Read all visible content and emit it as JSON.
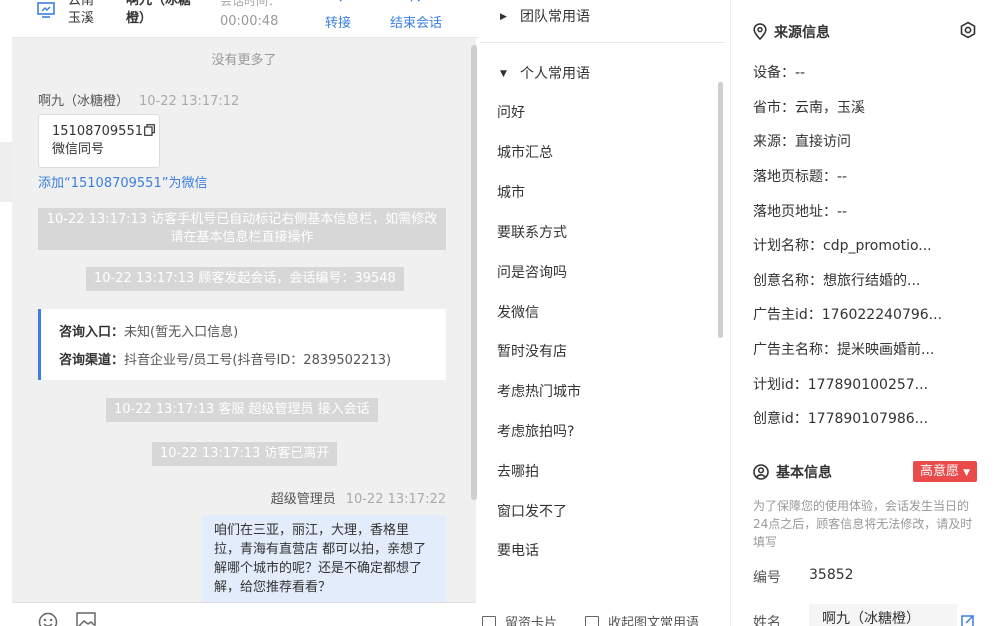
{
  "header": {
    "location": "云南玉溪",
    "visitor_name": "啊九（冰糖橙）",
    "session_time_label": "会话时间：",
    "session_time": "00:00:48",
    "transfer_label": "转接",
    "end_label": "结束会话"
  },
  "chat": {
    "no_more": "没有更多了",
    "visitor_msg": {
      "name": "啊九（冰糖橙）",
      "time": "10-22 13:17:12"
    },
    "card": {
      "line1": "15108709551",
      "line2": "微信同号"
    },
    "add_wechat": "添加“15108709551”为微信",
    "sys1": "10-22 13:17:13 访客手机号已自动标记右侧基本信息栏，如需修改请在基本信息栏直接操作",
    "sys2": "10-22 13:17:13 顾客发起会话，会话编号：39548",
    "entry": {
      "entry_label": "咨询入口：",
      "entry_value": "未知(暂无入口信息)",
      "channel_label": "咨询渠道：",
      "channel_value": "抖音企业号/员工号(抖音号ID：2839502213)"
    },
    "sys3": "10-22 13:17:13 客服 超级管理员 接入会话",
    "sys4": "10-22 13:17:13 访客已离开",
    "agent_msg": {
      "name": "超级管理员",
      "time": "10-22 13:17:22",
      "text": "咱们在三亚，丽江，大理，香格里拉，青海有直营店 都可以拍，亲想了解哪个城市的呢？还是不确定都想了解，给您推荐看看？"
    }
  },
  "phrases": {
    "team_group": "团队常用语",
    "personal_group": "个人常用语",
    "items": [
      "问好",
      "城市汇总",
      "城市",
      "要联系方式",
      "问是咨询吗",
      "发微信",
      "暂时没有店",
      "考虑热门城市",
      "考虑旅拍吗?",
      "去哪拍",
      "窗口发不了",
      "要电话"
    ],
    "bottom_left": "留资卡片",
    "bottom_right": "收起图文常用语"
  },
  "info": {
    "source_title": "来源信息",
    "rows": [
      "设备：--",
      "省市：云南，玉溪",
      "来源：直接访问",
      "落地页标题：--",
      "落地页地址：--",
      "计划名称：cdp_promotio...",
      "创意名称：想旅行结婚的...",
      "广告主id：176022240796...",
      "广告主名称：提米映画婚前...",
      "计划id：177890100257...",
      "创意id：177890107986..."
    ],
    "basic_title": "基本信息",
    "intent_badge": "高意愿",
    "note": "为了保障您的使用体验，会话发生当日的24点之后，顾客信息将无法修改，请及时填写",
    "number_label": "编号",
    "number_value": "35852",
    "name_label": "姓名",
    "name_value": "啊九（冰糖橙）"
  },
  "colors": {
    "accent": "#3b7fe0",
    "badge": "#ea4a4a",
    "agent_bubble": "#e3ecfb"
  }
}
